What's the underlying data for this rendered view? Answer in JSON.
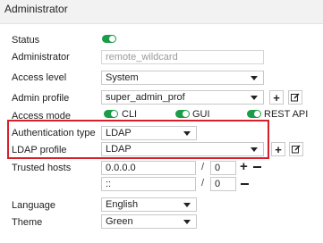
{
  "header": {
    "title": "Administrator"
  },
  "form": {
    "status": {
      "label": "Status",
      "enabled": true
    },
    "administrator": {
      "label": "Administrator",
      "value": "remote_wildcard"
    },
    "access_level": {
      "label": "Access level",
      "value": "System"
    },
    "admin_profile": {
      "label": "Admin profile",
      "value": "super_admin_prof"
    },
    "access_mode": {
      "label": "Access mode",
      "options": [
        {
          "label": "CLI",
          "enabled": true
        },
        {
          "label": "GUI",
          "enabled": true
        },
        {
          "label": "REST API",
          "enabled": true
        }
      ]
    },
    "authentication_type": {
      "label": "Authentication type",
      "value": "LDAP"
    },
    "ldap_profile": {
      "label": "LDAP profile",
      "value": "LDAP"
    },
    "trusted_hosts": {
      "label": "Trusted hosts",
      "rows": [
        {
          "address": "0.0.0.0",
          "separator": "/",
          "mask": "0"
        },
        {
          "address": "::",
          "separator": "/",
          "mask": "0"
        }
      ]
    },
    "language": {
      "label": "Language",
      "value": "English"
    },
    "theme": {
      "label": "Theme",
      "value": "Green"
    }
  },
  "colors": {
    "toggle_on": "#1a9c48",
    "highlight_border": "#d6202a",
    "header_bg": "#f2f2f2"
  }
}
